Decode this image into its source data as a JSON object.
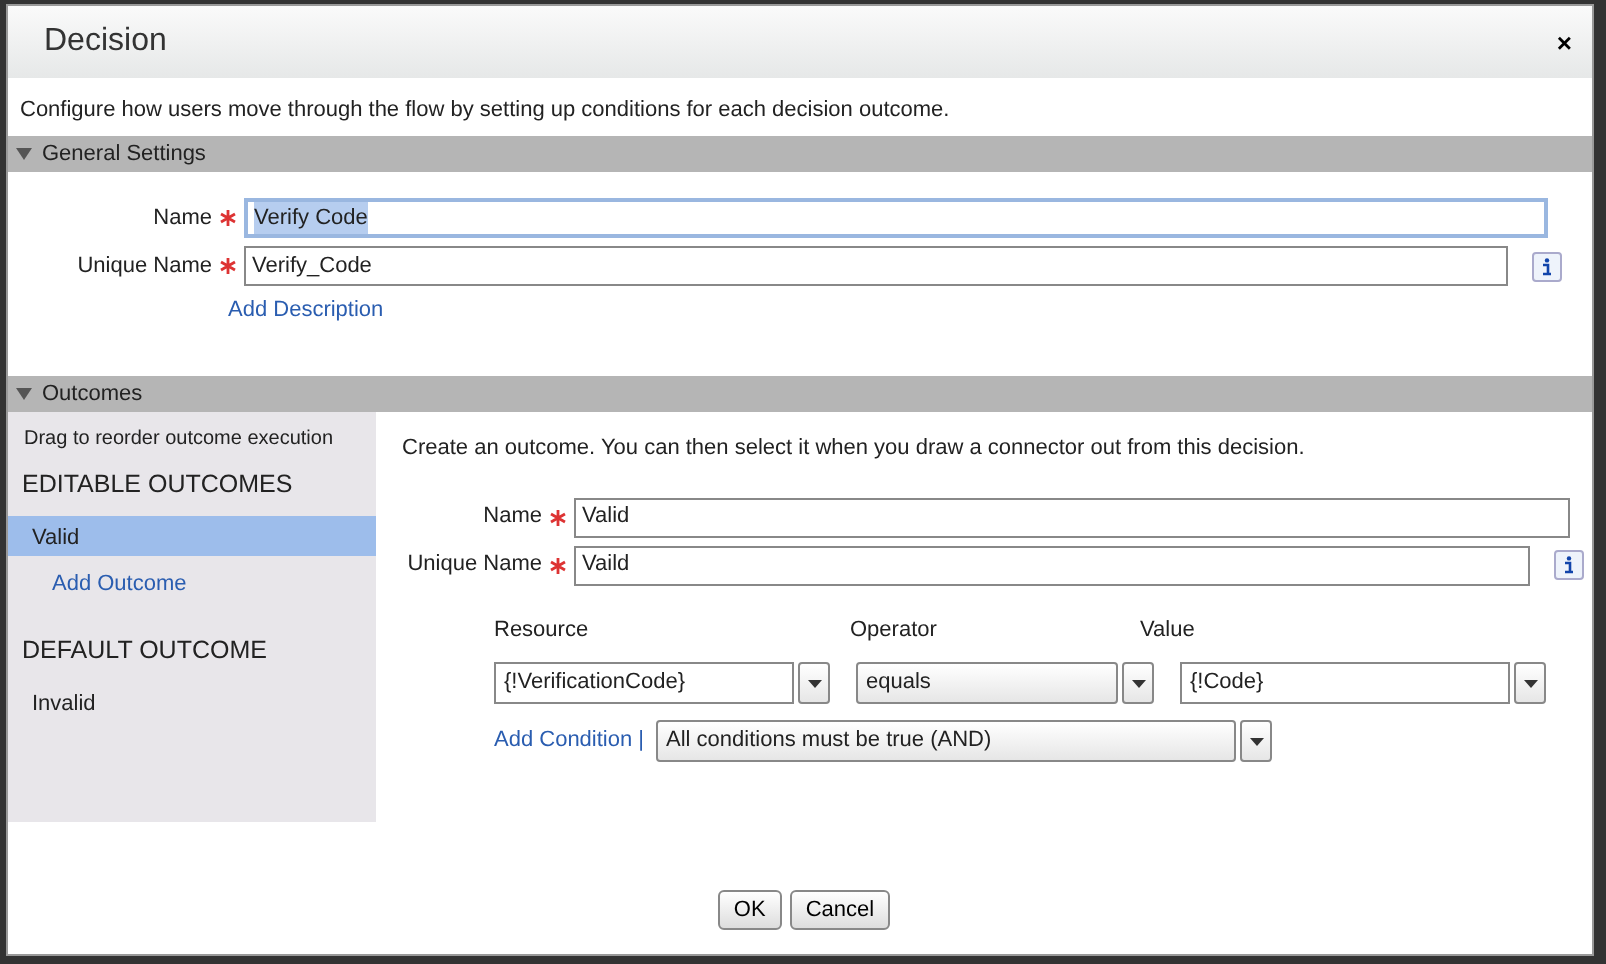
{
  "window": {
    "title": "Decision",
    "close": "×"
  },
  "description": "Configure how users move through the flow by setting up conditions for each decision outcome.",
  "sections": [
    {
      "title": "General Settings",
      "expanded": true
    },
    {
      "title": "Outcomes",
      "expanded": true
    }
  ],
  "general": {
    "fields": [
      {
        "label": "Name",
        "required": true,
        "value": "Verify Code",
        "focused": true,
        "info": false
      },
      {
        "label": "Unique Name",
        "required": true,
        "value": "Verify_Code",
        "focused": false,
        "info": true
      }
    ],
    "link": "Add Description"
  },
  "outcomes": {
    "hint": "Drag to reorder outcome execution",
    "editable_heading": "EDITABLE OUTCOMES",
    "editable": [
      {
        "label": "Valid",
        "selected": true
      }
    ],
    "add_link": "Add Outcome",
    "default_heading": "DEFAULT OUTCOME",
    "default": [
      {
        "label": "Invalid",
        "selected": false
      }
    ],
    "intro": "Create an outcome.  You can then select it when you draw a connector out from this decision.",
    "fields": [
      {
        "label": "Name",
        "required": true,
        "value": "Valid",
        "info": false
      },
      {
        "label": "Unique Name",
        "required": true,
        "value": "Vaild",
        "info": true
      }
    ],
    "condition_columns": [
      "Resource",
      "Operator",
      "Value"
    ],
    "conditions": [
      [
        "{!VerificationCode}",
        "equals",
        "{!Code}"
      ]
    ],
    "add_condition": "Add Condition |",
    "logic": "All conditions must be true (AND)"
  },
  "buttons": [
    "OK",
    "Cancel"
  ]
}
